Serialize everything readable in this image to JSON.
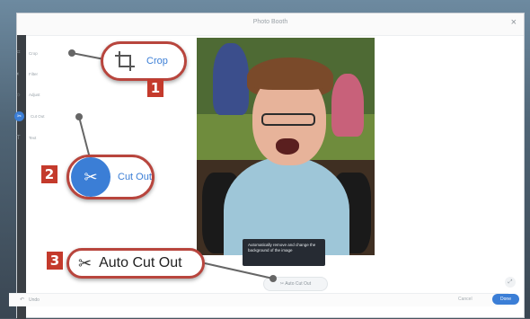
{
  "window": {
    "title": "Photo Booth",
    "close_glyph": "×"
  },
  "sidebar": {
    "items": [
      {
        "icon": "crop-icon",
        "glyph": "⌗",
        "label": "Crop"
      },
      {
        "icon": "filter-icon",
        "glyph": "◐",
        "label": "Filter"
      },
      {
        "icon": "adjust-icon",
        "glyph": "☼",
        "label": "Adjust"
      },
      {
        "icon": "cut-out-icon",
        "glyph": "✂",
        "label": "Cut Out"
      },
      {
        "icon": "text-icon",
        "glyph": "T",
        "label": "Text"
      }
    ]
  },
  "tooltip": {
    "text": "Automatically remove and change the background of the image"
  },
  "auto_cutout_button": {
    "label": "✂ Auto Cut Out"
  },
  "bottombar": {
    "left_label": "Undo",
    "cancel_label": "Cancel",
    "save_label": "Done"
  },
  "callouts": {
    "crop": {
      "label": "Crop",
      "badge": "1"
    },
    "cut_out": {
      "label": "Cut Out",
      "badge": "2"
    },
    "auto_cut_out": {
      "label": "Auto Cut Out",
      "badge": "3"
    }
  },
  "colors": {
    "accent": "#3b7ed6",
    "callout_border": "#b8453d",
    "badge": "#c43a2c"
  }
}
